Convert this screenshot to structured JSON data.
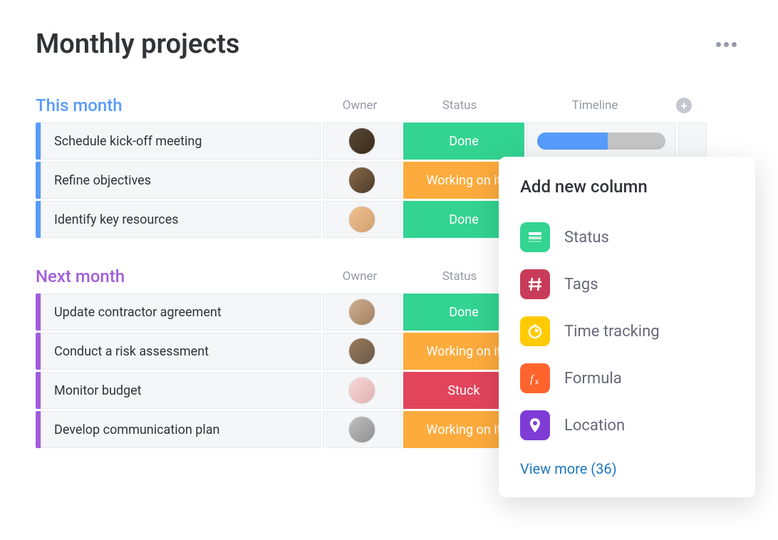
{
  "board": {
    "title": "Monthly projects",
    "columns": {
      "owner": "Owner",
      "status": "Status",
      "timeline": "Timeline"
    }
  },
  "groups": [
    {
      "title": "This month",
      "color": "blue",
      "rows": [
        {
          "name": "Schedule kick-off meeting",
          "status": "Done",
          "status_class": "done",
          "avatar": "a1"
        },
        {
          "name": "Refine objectives",
          "status": "Working on it",
          "status_class": "working",
          "avatar": "a2"
        },
        {
          "name": "Identify key resources",
          "status": "Done",
          "status_class": "done",
          "avatar": "a3"
        }
      ]
    },
    {
      "title": "Next month",
      "color": "purple",
      "rows": [
        {
          "name": "Update contractor agreement",
          "status": "Done",
          "status_class": "done",
          "avatar": "a4"
        },
        {
          "name": "Conduct a risk assessment",
          "status": "Working on it",
          "status_class": "working",
          "avatar": "a5"
        },
        {
          "name": "Monitor budget",
          "status": "Stuck",
          "status_class": "stuck",
          "avatar": "a6"
        },
        {
          "name": "Develop communication plan",
          "status": "Working on it",
          "status_class": "working",
          "avatar": "a7"
        }
      ]
    }
  ],
  "popup": {
    "title": "Add new column",
    "items": [
      {
        "label": "Status",
        "icon": "status"
      },
      {
        "label": "Tags",
        "icon": "tags"
      },
      {
        "label": "Time tracking",
        "icon": "time"
      },
      {
        "label": "Formula",
        "icon": "formula"
      },
      {
        "label": "Location",
        "icon": "location"
      }
    ],
    "view_more": "View more (36)"
  },
  "colors": {
    "done": "#33d391",
    "working": "#fdab3d",
    "stuck": "#e2445c"
  }
}
